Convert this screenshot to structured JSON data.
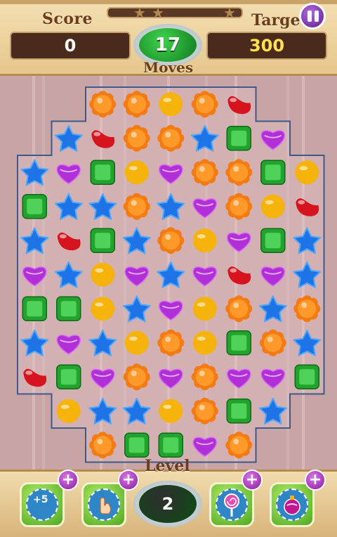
{
  "header": {
    "score_label": "Score",
    "score_value": "0",
    "target_label": "Target",
    "target_value": "300",
    "moves_value": "17",
    "moves_label": "Moves",
    "stars": 3,
    "progress": 0
  },
  "footer": {
    "level_label": "Level",
    "level_value": "2",
    "boosters": [
      {
        "name": "extra-moves",
        "text": "+5"
      },
      {
        "name": "hand"
      },
      {
        "name": "lollipop"
      },
      {
        "name": "color-bomb"
      }
    ],
    "plus_symbol": "+"
  },
  "colors": {
    "orange": "#f47a12",
    "red": "#d6141e",
    "yellow": "#f5b30b",
    "blue": "#1e74e6",
    "green": "#21a32d",
    "purple": "#b12fd6"
  },
  "board": {
    "cols": 9,
    "rows": 11,
    "legend": "O=orange flower, R=red bean, Y=yellow oval, B=blue star, G=green square, P=purple heart, .=empty",
    "rows_data": [
      "..OOYOR..",
      ".BROOBGP.",
      "BPGYPOOGY",
      "GBBOBPOYR",
      "BRGBOYPGB",
      "PBYPBPRPB",
      "GGYBPYOBO",
      "BPBYOYGOB",
      "RGPOPOPPG",
      ".YBBYOGB.",
      "..OGGPO.."
    ]
  }
}
